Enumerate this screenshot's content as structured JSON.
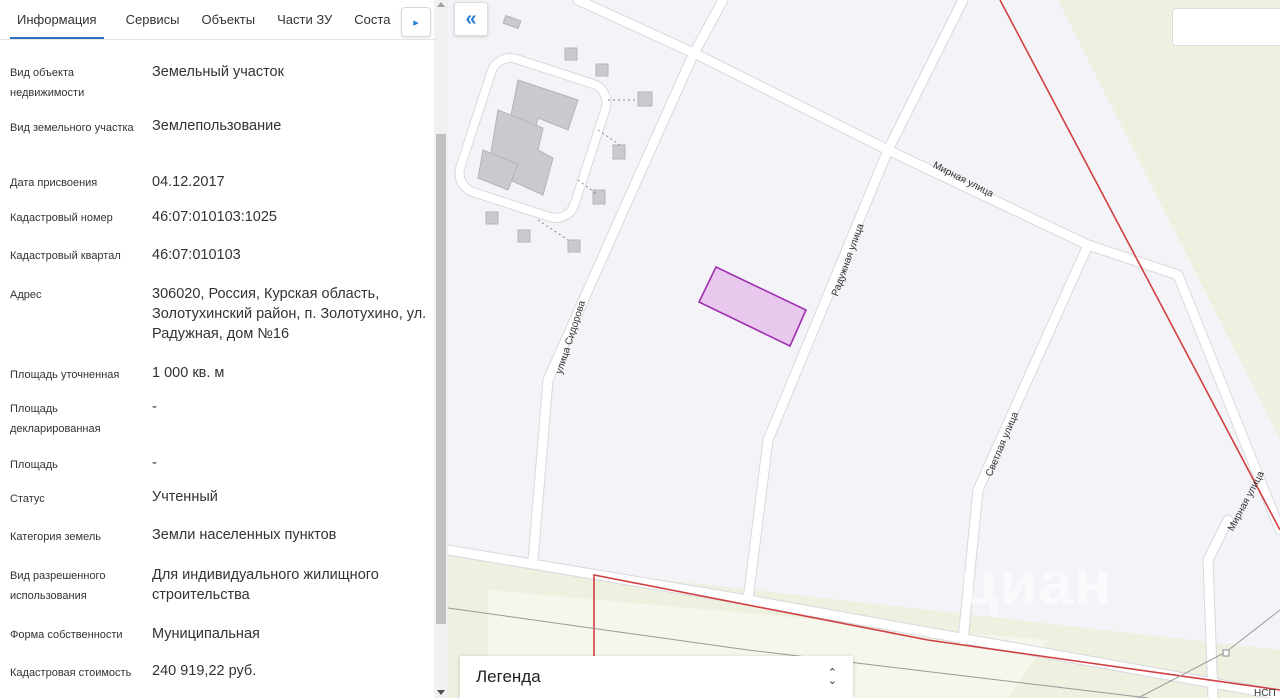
{
  "tabs": [
    {
      "label": "Информация",
      "active": true
    },
    {
      "label": "Сервисы",
      "active": false
    },
    {
      "label": "Объекты",
      "active": false
    },
    {
      "label": "Части ЗУ",
      "active": false
    },
    {
      "label": "Соста",
      "active": false
    }
  ],
  "tab_scroll_icon": "caret-right-icon",
  "properties": [
    {
      "label": "Вид объекта недвижимости",
      "value": "Земельный участок"
    },
    {
      "label": "Вид земельного участка",
      "value": "Землепользование"
    },
    {
      "label": "Дата присвоения",
      "value": "04.12.2017"
    },
    {
      "label": "Кадастровый номер",
      "value": "46:07:010103:1025"
    },
    {
      "label": "Кадастровый квартал",
      "value": "46:07:010103"
    },
    {
      "label": "Адрес",
      "value": "306020, Россия, Курская область, Золотухинский район, п. Золотухино, ул. Радужная, дом №16"
    },
    {
      "label": "Площадь уточненная",
      "value": "1 000 кв. м"
    },
    {
      "label": "Площадь декларированная",
      "value": "-"
    },
    {
      "label": "Площадь",
      "value": "-"
    },
    {
      "label": "Статус",
      "value": "Учтенный"
    },
    {
      "label": "Категория земель",
      "value": "Земли населенных пунктов"
    },
    {
      "label": "Вид разрешенного использования",
      "value": "Для индивидуального жилищного строительства"
    },
    {
      "label": "Форма собственности",
      "value": "Муниципальная"
    },
    {
      "label": "Кадастровая стоимость",
      "value": "240 919,22 руб."
    }
  ],
  "map": {
    "collapse_icon": "double-chevron-left-icon",
    "collapse_glyph": "«",
    "legend_label": "Легенда",
    "legend_icon": "chevron-up-down-icon",
    "watermark": "циан",
    "streets": {
      "mirnaya_1": "Мирная улица",
      "raduzhnaya": "Радужная улица",
      "sidorova": "улица Сидорова",
      "svetlaya": "Светлая улица",
      "mirnaya_2": "Мирная улица",
      "corner_label": "НСП"
    },
    "colors": {
      "parcel_fill": "#e8c8ec",
      "parcel_stroke": "#a030b0",
      "boundary": "#d04040",
      "road": "#ffffff",
      "ground": "#f4f4f8",
      "field": "#eef0e0"
    }
  }
}
